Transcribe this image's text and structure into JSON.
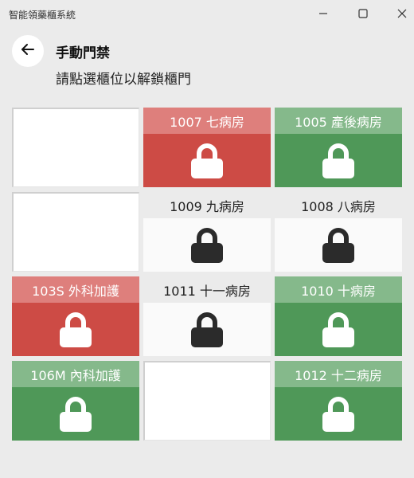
{
  "window": {
    "title": "智能領藥櫃系統",
    "controls": [
      "minimize-icon",
      "maximize-icon",
      "close-icon"
    ]
  },
  "header": {
    "back_icon": "arrow-left-icon",
    "title": "手動門禁",
    "subtitle": "請點選櫃位以解鎖櫃門"
  },
  "colors": {
    "locked_unlocked_red_header": "#de7f7c",
    "red_body": "#cd4b45",
    "green_header": "#85b98b",
    "green_body": "#4f9858",
    "gray_lock": "#2b2b2b"
  },
  "cabinets": [
    {
      "label": "",
      "state": "empty"
    },
    {
      "label": "1007 七病房",
      "state": "red"
    },
    {
      "label": "1005 產後病房",
      "state": "green"
    },
    {
      "label": "",
      "state": "empty"
    },
    {
      "label": "1009 九病房",
      "state": "gray"
    },
    {
      "label": "1008 八病房",
      "state": "gray"
    },
    {
      "label": "103S 外科加護",
      "state": "red"
    },
    {
      "label": "1011 十一病房",
      "state": "gray"
    },
    {
      "label": "1010 十病房",
      "state": "green"
    },
    {
      "label": "106M 內科加護",
      "state": "green"
    },
    {
      "label": "",
      "state": "empty"
    },
    {
      "label": "1012 十二病房",
      "state": "green"
    }
  ]
}
